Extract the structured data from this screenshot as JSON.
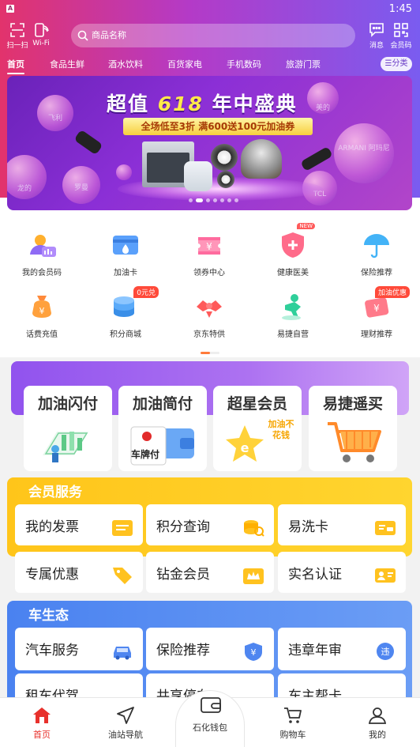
{
  "status": {
    "time": "1:45"
  },
  "topbar": {
    "scan_label": "扫一扫",
    "wifi_label": "Wi-Fi",
    "message_label": "消息",
    "vip_label": "会员码"
  },
  "search": {
    "placeholder": "商品名称"
  },
  "nav_tabs": [
    "首页",
    "食品生鲜",
    "酒水饮料",
    "百货家电",
    "手机数码",
    "旅游门票"
  ],
  "category_button": "分类",
  "banner": {
    "title_pre": "超值",
    "title_hl": "618",
    "title_post": "年中盛典",
    "ribbon": "全场低至3折  满600送100元加油券",
    "bubbles": [
      "飞利",
      "美的",
      "龙的",
      "罗曼",
      "ARMANI 阿玛尼",
      "TCL"
    ]
  },
  "grid": [
    {
      "label": "我的会员码",
      "icon": "member-code-icon"
    },
    {
      "label": "加油卡",
      "icon": "fuel-card-icon"
    },
    {
      "label": "领券中心",
      "icon": "coupon-icon"
    },
    {
      "label": "健康医美",
      "icon": "health-icon",
      "tag": "NEW"
    },
    {
      "label": "保险推荐",
      "icon": "umbrella-icon"
    },
    {
      "label": "话费充值",
      "icon": "money-bag-icon"
    },
    {
      "label": "积分商城",
      "icon": "coins-icon",
      "tag": "0元兑"
    },
    {
      "label": "京东特供",
      "icon": "gift-icon"
    },
    {
      "label": "易捷自营",
      "icon": "person-icon"
    },
    {
      "label": "理财推荐",
      "icon": "finance-icon",
      "tag": "加油优惠"
    }
  ],
  "promo_cards": [
    {
      "title": "加油闪付",
      "icon": "flash-pay-icon"
    },
    {
      "title": "加油简付",
      "icon": "plate-pay-icon",
      "badge": "车牌付"
    },
    {
      "title": "超星会员",
      "icon": "star-member-icon",
      "badge": "加油不花钱"
    },
    {
      "title": "易捷遥买",
      "icon": "cart-icon"
    }
  ],
  "member_services": {
    "title": "会员服务",
    "items": [
      "我的发票",
      "积分查询",
      "易洗卡",
      "专属优惠",
      "钻金会员",
      "实名认证"
    ]
  },
  "car_ecology": {
    "title": "车生态",
    "items": [
      "汽车服务",
      "保险推荐",
      "违章年审",
      "租车代驾",
      "共享停车",
      "车主帮卡"
    ]
  },
  "bottom_nav": [
    "首页",
    "油站导航",
    "石化钱包",
    "购物车",
    "我的"
  ],
  "colors": {
    "brand_red": "#e8312c",
    "header_start": "#e2336c",
    "header_end": "#7a5cf0",
    "member_yellow": "#fdc610",
    "car_blue": "#5b8ef2"
  }
}
